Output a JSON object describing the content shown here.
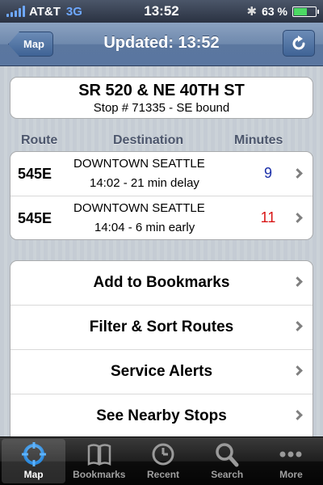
{
  "status": {
    "carrier": "AT&T",
    "network": "3G",
    "time": "13:52",
    "battery_text": "63 %",
    "battery_level": 0.63
  },
  "nav": {
    "back_label": "Map",
    "title": "Updated: 13:52",
    "refresh_icon": "refresh-icon"
  },
  "stop": {
    "name": "SR 520 & NE 40TH ST",
    "info": "Stop # 71335 - SE bound"
  },
  "columns": {
    "route": "Route",
    "destination": "Destination",
    "minutes": "Minutes"
  },
  "arrivals": [
    {
      "route": "545E",
      "destination": "DOWNTOWN SEATTLE",
      "detail": "14:02 - 21 min delay",
      "minutes": "9",
      "color": "#1a2ea8"
    },
    {
      "route": "545E",
      "destination": "DOWNTOWN SEATTLE",
      "detail": "14:04 - 6 min early",
      "minutes": "11",
      "color": "#d81616"
    }
  ],
  "actions": [
    "Add to Bookmarks",
    "Filter & Sort Routes",
    "Service Alerts",
    "See Nearby Stops"
  ],
  "tabs": [
    {
      "label": "Map",
      "icon": "map-crosshair-icon",
      "active": true
    },
    {
      "label": "Bookmarks",
      "icon": "book-icon",
      "active": false
    },
    {
      "label": "Recent",
      "icon": "clock-icon",
      "active": false
    },
    {
      "label": "Search",
      "icon": "magnifier-icon",
      "active": false
    },
    {
      "label": "More",
      "icon": "more-dots-icon",
      "active": false
    }
  ]
}
